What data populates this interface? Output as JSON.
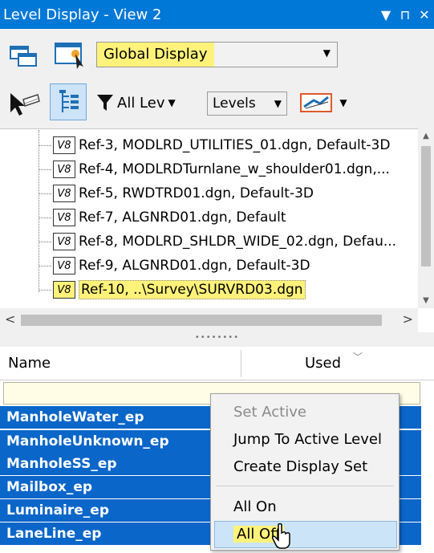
{
  "window": {
    "title": "Level Display - View 2",
    "dropdown_glyph": "▼",
    "pin_glyph": "⊓",
    "close_glyph": "✕"
  },
  "toolbar": {
    "display_combo_value": "Global Display",
    "filter_label": "All Lev",
    "levels_combo_value": "Levels"
  },
  "tree": {
    "items": [
      {
        "badge": "V8",
        "label": "Ref-3, MODLRD_UTILITIES_01.dgn, Default-3D"
      },
      {
        "badge": "V8",
        "label": "Ref-4, MODLRDTurnlane_w_shoulder01.dgn,..."
      },
      {
        "badge": "V8",
        "label": "Ref-5, RWDTRD01.dgn, Default-3D"
      },
      {
        "badge": "V8",
        "label": "Ref-7, ALGNRD01.dgn, Default"
      },
      {
        "badge": "V8",
        "label": "Ref-8, MODLRD_SHLDR_WIDE_02.dgn, Defau..."
      },
      {
        "badge": "V8",
        "label": "Ref-9, ALGNRD01.dgn, Default-3D"
      },
      {
        "badge": "V8",
        "label": "Ref-10, ..\\Survey\\SURVRD03.dgn"
      }
    ]
  },
  "splitter": {
    "grip": "••••••••"
  },
  "levels_table": {
    "columns": {
      "name": "Name",
      "used": "Used"
    },
    "rows": [
      {
        "name": "ManholeWater_ep"
      },
      {
        "name": "ManholeUnknown_ep"
      },
      {
        "name": "ManholeSS_ep"
      },
      {
        "name": "Mailbox_ep"
      },
      {
        "name": "Luminaire_ep"
      },
      {
        "name": "LaneLine_ep"
      }
    ]
  },
  "context_menu": {
    "set_active": "Set Active",
    "jump_to_active_level": "Jump To Active Level",
    "create_display_set": "Create Display Set",
    "all_on": "All On",
    "all_off": "All Off"
  },
  "colors": {
    "titlebar": "#0078d7",
    "selection": "#0a66c9",
    "highlight": "#fff27a",
    "menu_hover": "#cce4f7"
  }
}
